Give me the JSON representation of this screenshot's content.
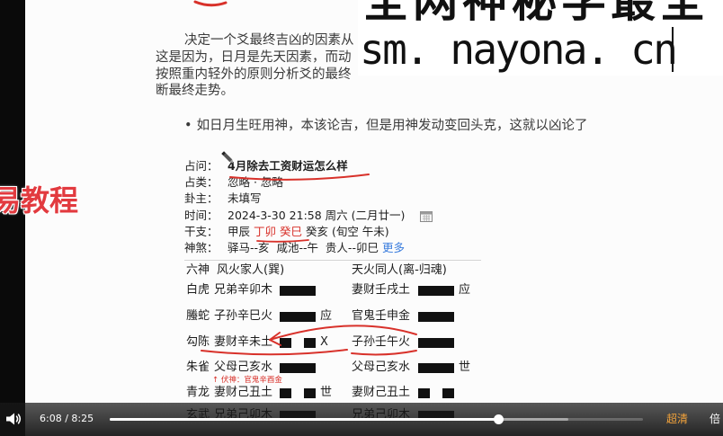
{
  "colors": {
    "annotation_red": "#d8312a",
    "link_blue": "#3b7ddd",
    "quality_orange": "#f3a33a",
    "watermark_red": "#e23a3f"
  },
  "watermarks": {
    "top_banner": "全网神秘学最全",
    "site_url": "sm. nayona. cn",
    "side_label": "易教程"
  },
  "document": {
    "paragraph_lines": [
      "决定一个爻最终吉凶的因素从",
      "这是因为，日月是先天因素，而动",
      "按照重内轻外的原则分析爻的最终",
      "断最终走势。"
    ],
    "bullet_symbol": "•",
    "bullet_text": "如日月生旺用神，本该论吉，但是用神发动变回头克，这就以凶论了"
  },
  "divination": {
    "question": {
      "label": "占问：",
      "value": "4月除去工资财运怎么样"
    },
    "category": {
      "label": "占类：",
      "value": "忽略 · 忽略"
    },
    "querent": {
      "label": "卦主：",
      "value": "未填写"
    },
    "time": {
      "label": "时间：",
      "value": "2024-3-30 21:58 周六 (二月廿一)"
    },
    "ganzhi": {
      "label": "干支：",
      "year": "甲辰",
      "month_day": "丁卯 癸巳",
      "rest": "癸亥 (旬空 午未)"
    },
    "shensha": {
      "label": "神煞：",
      "value": "驿马--亥  咸池--午  贵人--卯巳 ",
      "more_link": "更多"
    }
  },
  "hexagram": {
    "header": {
      "liushen_label": "六神",
      "main_name": "风火家人(巽)",
      "changed_name": "天火同人(离-归魂)"
    },
    "rows": [
      {
        "liushen": "白虎",
        "main": {
          "text": "兄弟辛卯木",
          "line": "yang",
          "mark": ""
        },
        "changed": {
          "text": "妻财壬戌土",
          "line": "yang",
          "mark": "应"
        }
      },
      {
        "liushen": "螣蛇",
        "main": {
          "text": "子孙辛巳火",
          "line": "yang",
          "mark": "应"
        },
        "changed": {
          "text": "官鬼壬申金",
          "line": "yang",
          "mark": ""
        }
      },
      {
        "liushen": "勾陈",
        "main": {
          "text": "妻财辛未土",
          "line": "yin",
          "mark": "X"
        },
        "changed": {
          "text": "子孙壬午火",
          "line": "yang",
          "mark": ""
        }
      },
      {
        "liushen": "朱雀",
        "main": {
          "text": "父母己亥水",
          "line": "yang",
          "mark": ""
        },
        "changed": {
          "text": "父母己亥水",
          "line": "yang",
          "mark": "世"
        }
      },
      {
        "liushen": "青龙",
        "main": {
          "text": "妻财己丑土",
          "line": "yin",
          "mark": "世"
        },
        "changed": {
          "text": "妻财己丑土",
          "line": "yin",
          "mark": ""
        }
      },
      {
        "liushen": "玄武",
        "main": {
          "text": "兄弟己卯木",
          "line": "yang",
          "mark": ""
        },
        "changed": {
          "text": "兄弟己卯木",
          "line": "yang",
          "mark": ""
        }
      }
    ],
    "fushen_note": "↑ 伏神：官鬼辛酉金"
  },
  "player": {
    "volume_icon": "volume-icon",
    "current_time": "6:08",
    "time_separator": "/",
    "duration": "8:25",
    "played_fraction": 0.729,
    "buffered_fraction": 0.86,
    "quality_label": "超清",
    "speed_label": "倍"
  }
}
